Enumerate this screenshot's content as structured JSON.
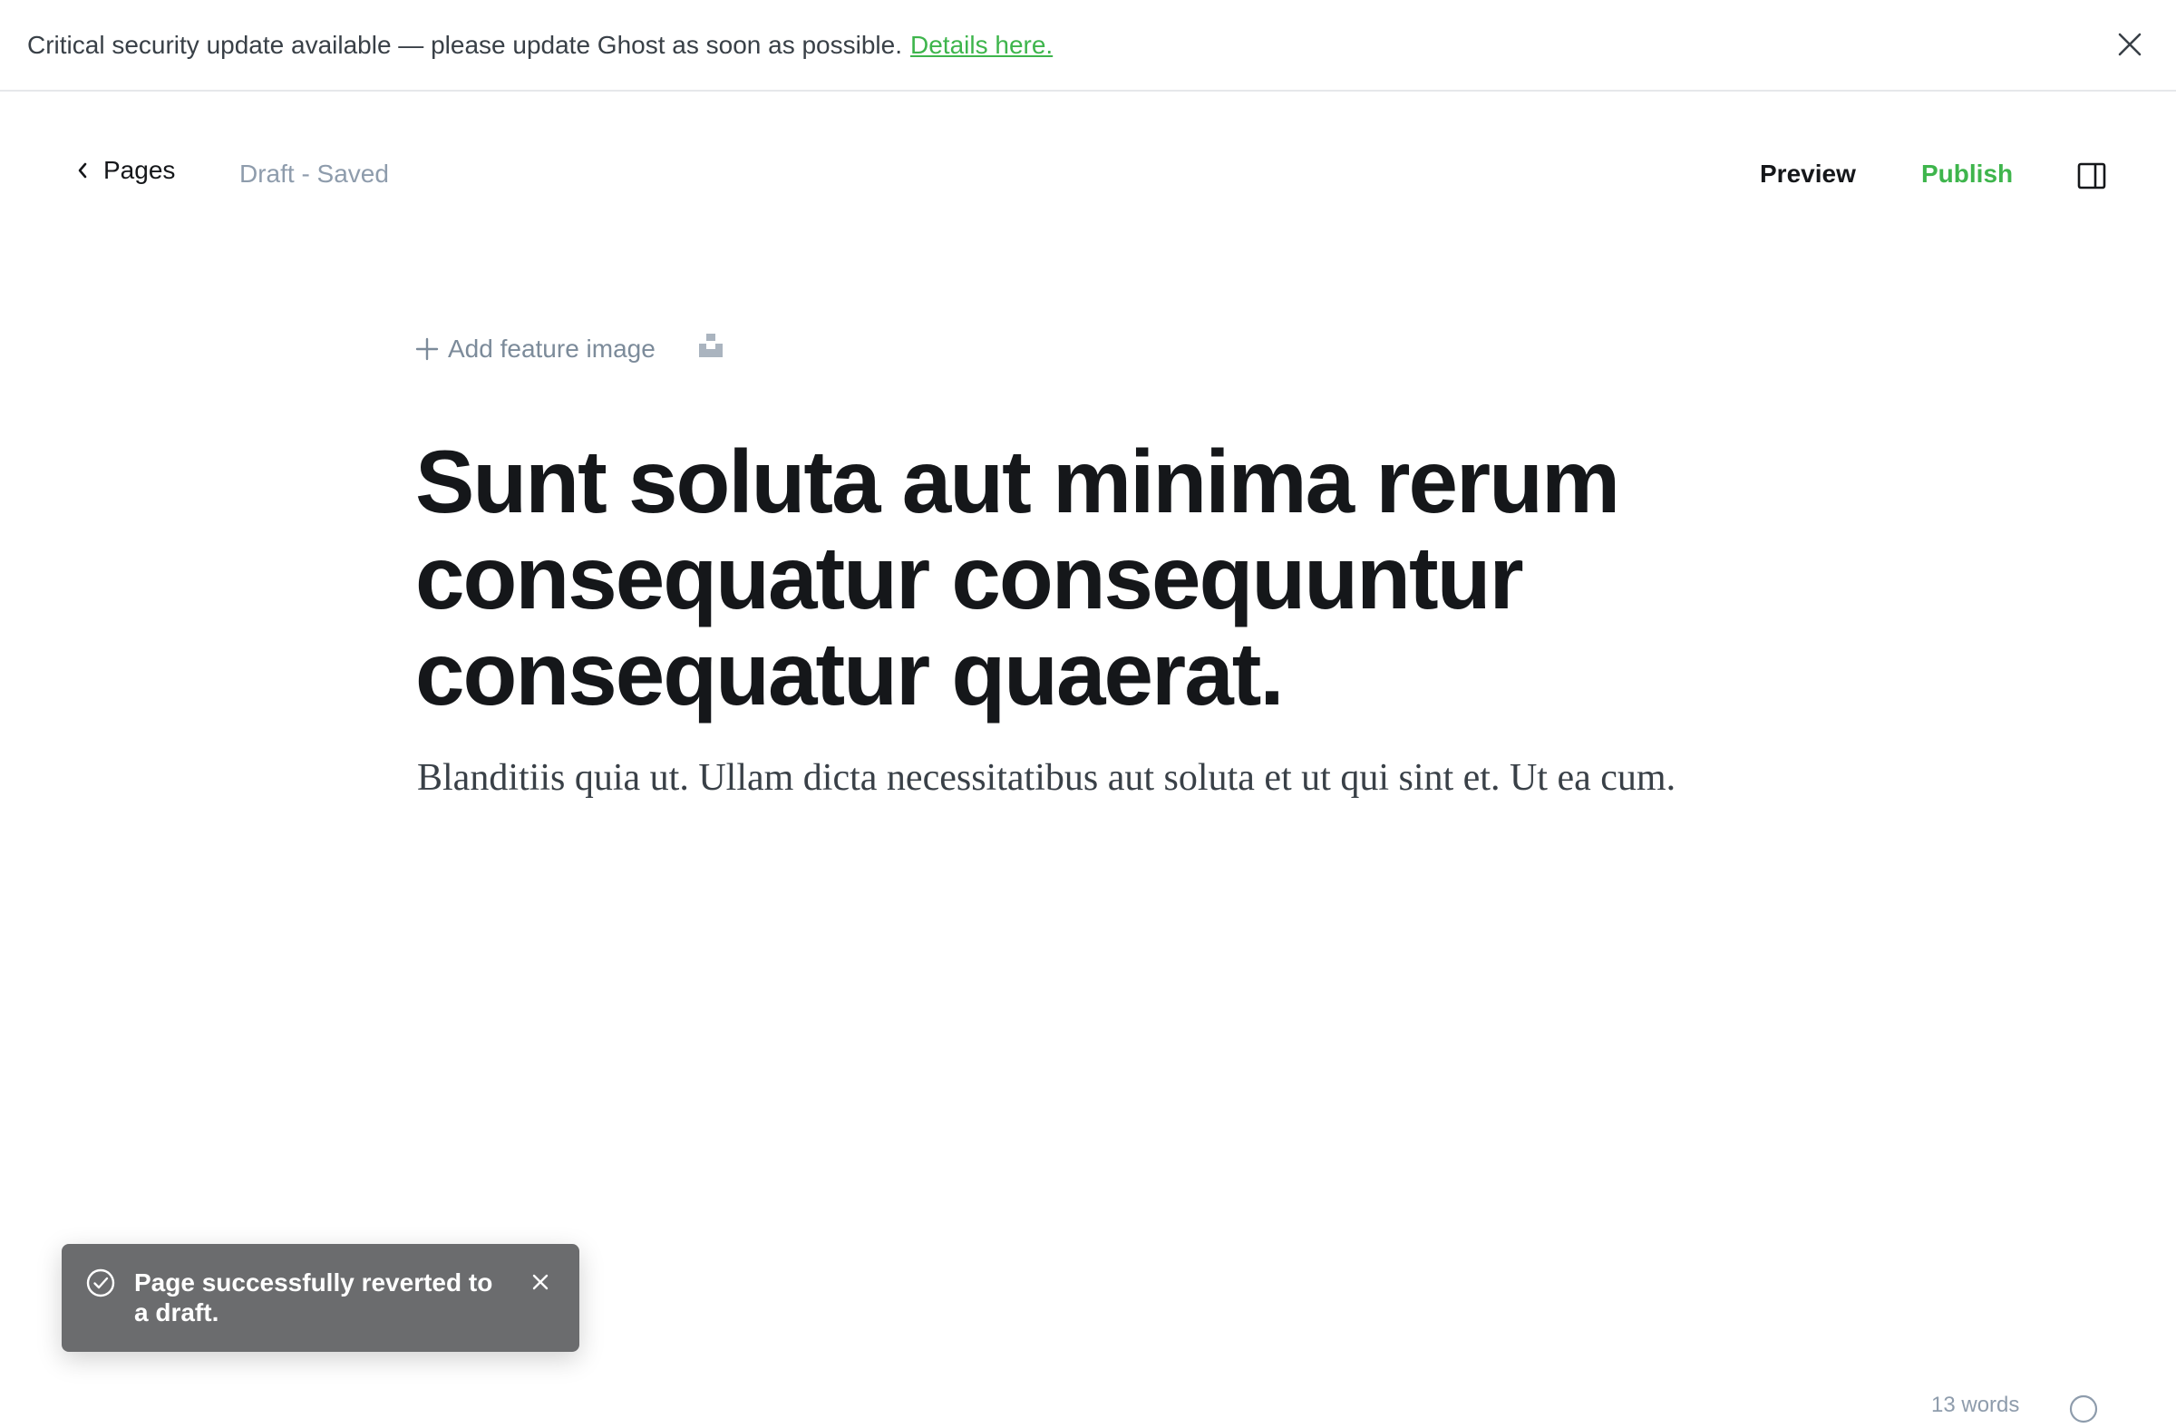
{
  "banner": {
    "message": "Critical security update available — please update Ghost as soon as possible.",
    "link_label": "Details here.",
    "link_color": "#3eb54c",
    "close_icon": "close-icon"
  },
  "editor_header": {
    "back_label": "Pages",
    "back_icon": "chevron-left-icon",
    "status": "Draft - Saved",
    "preview_label": "Preview",
    "publish_label": "Publish",
    "publish_color": "#3eb54c",
    "sidebar_icon": "sidebar-toggle-icon"
  },
  "feature_image": {
    "add_label": "Add feature image",
    "plus_icon": "plus-icon",
    "unsplash_icon": "unsplash-icon"
  },
  "post": {
    "title": "Sunt soluta aut minima rerum consequatur consequuntur consequatur quaerat.",
    "excerpt": "Blanditiis quia ut. Ullam dicta necessitatibus aut soluta et ut qui sint et. Ut ea cum."
  },
  "toast": {
    "message": "Page successfully reverted to a draft.",
    "check_icon": "check-circle-icon",
    "close_icon": "close-icon",
    "background": "#6b6c6e"
  },
  "footer": {
    "word_count": "13 words",
    "help_icon": "help-icon"
  }
}
